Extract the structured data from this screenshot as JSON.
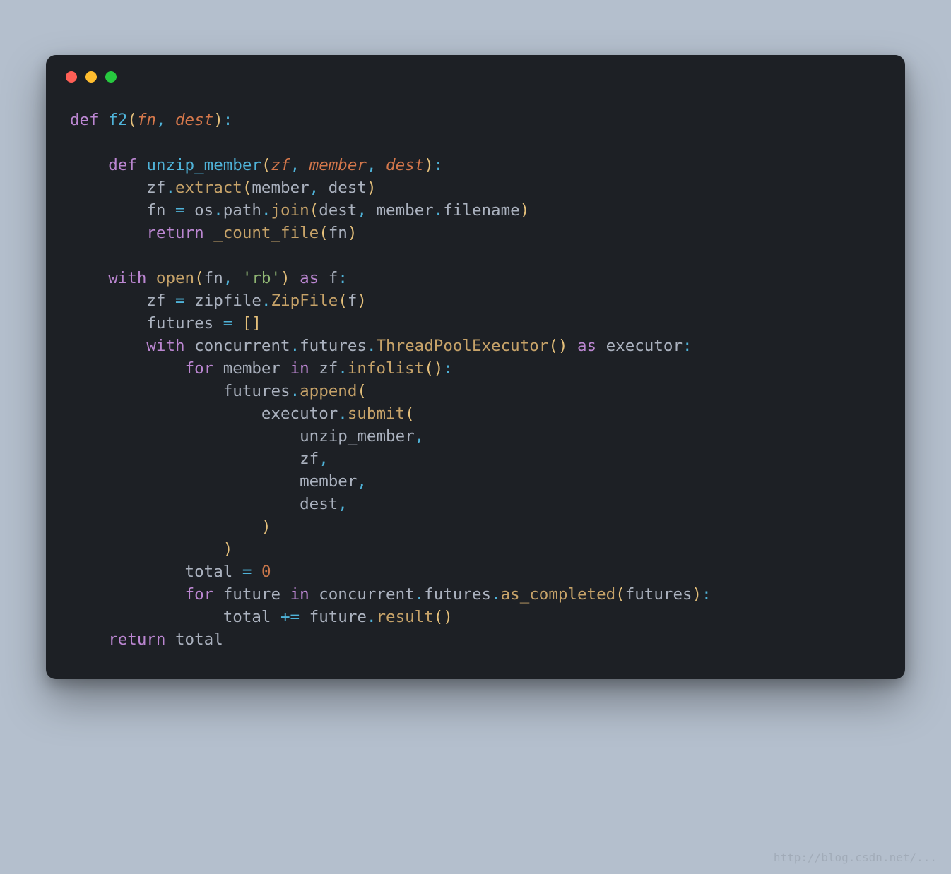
{
  "window": {
    "traffic_lights": [
      "close",
      "minimize",
      "zoom"
    ]
  },
  "code": {
    "lines": [
      [
        {
          "cls": "kw",
          "t": "def"
        },
        {
          "cls": "id",
          "t": " "
        },
        {
          "cls": "fn",
          "t": "f2"
        },
        {
          "cls": "pn",
          "t": "("
        },
        {
          "cls": "pm",
          "t": "fn"
        },
        {
          "cls": "op",
          "t": ","
        },
        {
          "cls": "id",
          "t": " "
        },
        {
          "cls": "pm",
          "t": "dest"
        },
        {
          "cls": "pn",
          "t": ")"
        },
        {
          "cls": "op",
          "t": ":"
        }
      ],
      [],
      [
        {
          "cls": "id",
          "t": "    "
        },
        {
          "cls": "kw",
          "t": "def"
        },
        {
          "cls": "id",
          "t": " "
        },
        {
          "cls": "fn",
          "t": "unzip_member"
        },
        {
          "cls": "pn",
          "t": "("
        },
        {
          "cls": "pm",
          "t": "zf"
        },
        {
          "cls": "op",
          "t": ","
        },
        {
          "cls": "id",
          "t": " "
        },
        {
          "cls": "pm",
          "t": "member"
        },
        {
          "cls": "op",
          "t": ","
        },
        {
          "cls": "id",
          "t": " "
        },
        {
          "cls": "pm",
          "t": "dest"
        },
        {
          "cls": "pn",
          "t": ")"
        },
        {
          "cls": "op",
          "t": ":"
        }
      ],
      [
        {
          "cls": "id",
          "t": "        zf"
        },
        {
          "cls": "op",
          "t": "."
        },
        {
          "cls": "call",
          "t": "extract"
        },
        {
          "cls": "pn",
          "t": "("
        },
        {
          "cls": "id",
          "t": "member"
        },
        {
          "cls": "op",
          "t": ","
        },
        {
          "cls": "id",
          "t": " dest"
        },
        {
          "cls": "pn",
          "t": ")"
        }
      ],
      [
        {
          "cls": "id",
          "t": "        fn "
        },
        {
          "cls": "op",
          "t": "="
        },
        {
          "cls": "id",
          "t": " os"
        },
        {
          "cls": "op",
          "t": "."
        },
        {
          "cls": "id",
          "t": "path"
        },
        {
          "cls": "op",
          "t": "."
        },
        {
          "cls": "call",
          "t": "join"
        },
        {
          "cls": "pn",
          "t": "("
        },
        {
          "cls": "id",
          "t": "dest"
        },
        {
          "cls": "op",
          "t": ","
        },
        {
          "cls": "id",
          "t": " member"
        },
        {
          "cls": "op",
          "t": "."
        },
        {
          "cls": "id",
          "t": "filename"
        },
        {
          "cls": "pn",
          "t": ")"
        }
      ],
      [
        {
          "cls": "id",
          "t": "        "
        },
        {
          "cls": "kw",
          "t": "return"
        },
        {
          "cls": "id",
          "t": " "
        },
        {
          "cls": "call",
          "t": "_count_file"
        },
        {
          "cls": "pn",
          "t": "("
        },
        {
          "cls": "id",
          "t": "fn"
        },
        {
          "cls": "pn",
          "t": ")"
        }
      ],
      [],
      [
        {
          "cls": "id",
          "t": "    "
        },
        {
          "cls": "kw",
          "t": "with"
        },
        {
          "cls": "id",
          "t": " "
        },
        {
          "cls": "call",
          "t": "open"
        },
        {
          "cls": "pn",
          "t": "("
        },
        {
          "cls": "id",
          "t": "fn"
        },
        {
          "cls": "op",
          "t": ","
        },
        {
          "cls": "id",
          "t": " "
        },
        {
          "cls": "str",
          "t": "'rb'"
        },
        {
          "cls": "pn",
          "t": ")"
        },
        {
          "cls": "id",
          "t": " "
        },
        {
          "cls": "kw",
          "t": "as"
        },
        {
          "cls": "id",
          "t": " f"
        },
        {
          "cls": "op",
          "t": ":"
        }
      ],
      [
        {
          "cls": "id",
          "t": "        zf "
        },
        {
          "cls": "op",
          "t": "="
        },
        {
          "cls": "id",
          "t": " zipfile"
        },
        {
          "cls": "op",
          "t": "."
        },
        {
          "cls": "call",
          "t": "ZipFile"
        },
        {
          "cls": "pn",
          "t": "("
        },
        {
          "cls": "id",
          "t": "f"
        },
        {
          "cls": "pn",
          "t": ")"
        }
      ],
      [
        {
          "cls": "id",
          "t": "        futures "
        },
        {
          "cls": "op",
          "t": "="
        },
        {
          "cls": "id",
          "t": " "
        },
        {
          "cls": "pn",
          "t": "[]"
        }
      ],
      [
        {
          "cls": "id",
          "t": "        "
        },
        {
          "cls": "kw",
          "t": "with"
        },
        {
          "cls": "id",
          "t": " concurrent"
        },
        {
          "cls": "op",
          "t": "."
        },
        {
          "cls": "id",
          "t": "futures"
        },
        {
          "cls": "op",
          "t": "."
        },
        {
          "cls": "call",
          "t": "ThreadPoolExecutor"
        },
        {
          "cls": "pn",
          "t": "()"
        },
        {
          "cls": "id",
          "t": " "
        },
        {
          "cls": "kw",
          "t": "as"
        },
        {
          "cls": "id",
          "t": " executor"
        },
        {
          "cls": "op",
          "t": ":"
        }
      ],
      [
        {
          "cls": "id",
          "t": "            "
        },
        {
          "cls": "kw",
          "t": "for"
        },
        {
          "cls": "id",
          "t": " member "
        },
        {
          "cls": "kw",
          "t": "in"
        },
        {
          "cls": "id",
          "t": " zf"
        },
        {
          "cls": "op",
          "t": "."
        },
        {
          "cls": "call",
          "t": "infolist"
        },
        {
          "cls": "pn",
          "t": "()"
        },
        {
          "cls": "op",
          "t": ":"
        }
      ],
      [
        {
          "cls": "id",
          "t": "                futures"
        },
        {
          "cls": "op",
          "t": "."
        },
        {
          "cls": "call",
          "t": "append"
        },
        {
          "cls": "pn",
          "t": "("
        }
      ],
      [
        {
          "cls": "id",
          "t": "                    executor"
        },
        {
          "cls": "op",
          "t": "."
        },
        {
          "cls": "call",
          "t": "submit"
        },
        {
          "cls": "pn",
          "t": "("
        }
      ],
      [
        {
          "cls": "id",
          "t": "                        unzip_member"
        },
        {
          "cls": "op",
          "t": ","
        }
      ],
      [
        {
          "cls": "id",
          "t": "                        zf"
        },
        {
          "cls": "op",
          "t": ","
        }
      ],
      [
        {
          "cls": "id",
          "t": "                        member"
        },
        {
          "cls": "op",
          "t": ","
        }
      ],
      [
        {
          "cls": "id",
          "t": "                        dest"
        },
        {
          "cls": "op",
          "t": ","
        }
      ],
      [
        {
          "cls": "id",
          "t": "                    "
        },
        {
          "cls": "pn",
          "t": ")"
        }
      ],
      [
        {
          "cls": "id",
          "t": "                "
        },
        {
          "cls": "pn",
          "t": ")"
        }
      ],
      [
        {
          "cls": "id",
          "t": "            total "
        },
        {
          "cls": "op",
          "t": "="
        },
        {
          "cls": "id",
          "t": " "
        },
        {
          "cls": "num",
          "t": "0"
        }
      ],
      [
        {
          "cls": "id",
          "t": "            "
        },
        {
          "cls": "kw",
          "t": "for"
        },
        {
          "cls": "id",
          "t": " future "
        },
        {
          "cls": "kw",
          "t": "in"
        },
        {
          "cls": "id",
          "t": " concurrent"
        },
        {
          "cls": "op",
          "t": "."
        },
        {
          "cls": "id",
          "t": "futures"
        },
        {
          "cls": "op",
          "t": "."
        },
        {
          "cls": "call",
          "t": "as_completed"
        },
        {
          "cls": "pn",
          "t": "("
        },
        {
          "cls": "id",
          "t": "futures"
        },
        {
          "cls": "pn",
          "t": ")"
        },
        {
          "cls": "op",
          "t": ":"
        }
      ],
      [
        {
          "cls": "id",
          "t": "                total "
        },
        {
          "cls": "op",
          "t": "+="
        },
        {
          "cls": "id",
          "t": " future"
        },
        {
          "cls": "op",
          "t": "."
        },
        {
          "cls": "call",
          "t": "result"
        },
        {
          "cls": "pn",
          "t": "()"
        }
      ],
      [
        {
          "cls": "id",
          "t": "    "
        },
        {
          "cls": "kw",
          "t": "return"
        },
        {
          "cls": "id",
          "t": " total"
        }
      ]
    ]
  },
  "watermark": "http://blog.csdn.net/..."
}
